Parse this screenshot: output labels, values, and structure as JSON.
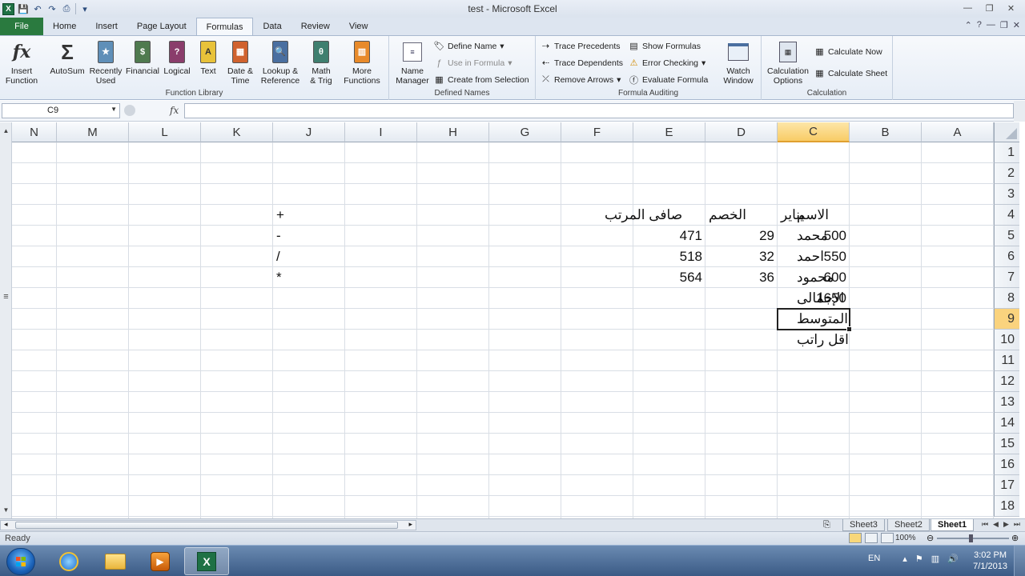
{
  "window": {
    "title": "test  -  Microsoft Excel",
    "minimize_icon": "minimize-icon",
    "restore_icon": "restore-icon",
    "close_icon": "close-icon"
  },
  "ribbon_tabs": [
    "File",
    "Home",
    "Insert",
    "Page Layout",
    "Formulas",
    "Data",
    "Review",
    "View"
  ],
  "active_tab": "Formulas",
  "function_library": {
    "label": "Function Library",
    "insert_function": [
      "Insert",
      "Function"
    ],
    "autosum": "AutoSum",
    "recently_used": [
      "Recently",
      "Used"
    ],
    "financial": "Financial",
    "logical": "Logical",
    "text": "Text",
    "date_time": [
      "Date &",
      "Time"
    ],
    "lookup_reference": [
      "Lookup &",
      "Reference"
    ],
    "math_trig": [
      "Math",
      "& Trig"
    ],
    "more_functions": [
      "More",
      "Functions"
    ]
  },
  "defined_names": {
    "label": "Defined Names",
    "name_manager": [
      "Name",
      "Manager"
    ],
    "define_name": "Define Name",
    "use_in_formula": "Use in Formula",
    "create_from_selection": "Create from Selection"
  },
  "formula_auditing": {
    "label": "Formula Auditing",
    "trace_precedents": "Trace Precedents",
    "trace_dependents": "Trace Dependents",
    "remove_arrows": "Remove Arrows",
    "show_formulas": "Show Formulas",
    "error_checking": "Error Checking",
    "evaluate_formula": "Evaluate Formula",
    "watch_window": [
      "Watch",
      "Window"
    ]
  },
  "calculation": {
    "label": "Calculation",
    "calculation_options": [
      "Calculation",
      "Options"
    ],
    "calculate_now": "Calculate Now",
    "calculate_sheet": "Calculate Sheet"
  },
  "formula_bar": {
    "name_box": "C9",
    "fx": "fx",
    "content": ""
  },
  "columns": [
    "N",
    "M",
    "L",
    "K",
    "J",
    "I",
    "H",
    "G",
    "F",
    "E",
    "D",
    "C",
    "B",
    "A"
  ],
  "selected_column": "C",
  "rows": [
    "1",
    "2",
    "3",
    "4",
    "5",
    "6",
    "7",
    "8",
    "9",
    "10",
    "11",
    "12",
    "13",
    "14",
    "15",
    "16",
    "17",
    "18"
  ],
  "selected_row": "9",
  "cells": {
    "B4": "الاسم",
    "C4": "يناير",
    "D4": "الخصم",
    "E4": "صافى المرتب",
    "B5": "محمد",
    "C5": "500",
    "D5": "29",
    "E5": "471",
    "B6": "احمد",
    "C6": "550",
    "D6": "32",
    "E6": "518",
    "B7": "محمود",
    "C7": "600",
    "D7": "36",
    "E7": "564",
    "B8": "الإجمالى",
    "C8": "1650",
    "B9": "المتوسط",
    "B10": "اقل راتب",
    "J4": "+",
    "J5": "-",
    "J6": "/",
    "J7": "*"
  },
  "sheets": [
    "Sheet3",
    "Sheet2",
    "Sheet1"
  ],
  "active_sheet": "Sheet1",
  "status": {
    "text": "Ready",
    "zoom": "100%"
  },
  "taskbar": {
    "language": "EN",
    "time": "3:02 PM",
    "date": "7/1/2013"
  }
}
